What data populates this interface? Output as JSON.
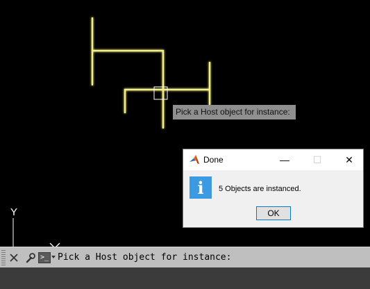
{
  "viewport": {
    "tooltip": "Pick a Host object for instance:",
    "ucs_y_label": "Y",
    "colors": {
      "background": "#000000",
      "geometry": "#f3f08a",
      "glow": "#fffbb0"
    }
  },
  "dialog": {
    "title": "Done",
    "message": "5 Objects are instanced.",
    "ok_label": "OK",
    "min_glyph": "—",
    "max_glyph": "☐",
    "close_glyph": "✕",
    "info_glyph": "i",
    "app_icon": "matlab-icon"
  },
  "command_line": {
    "prompt_glyph": ">_",
    "text": "Pick a Host object for instance:",
    "icons": [
      "close-icon",
      "wrench-icon",
      "command-prompt-icon"
    ]
  }
}
